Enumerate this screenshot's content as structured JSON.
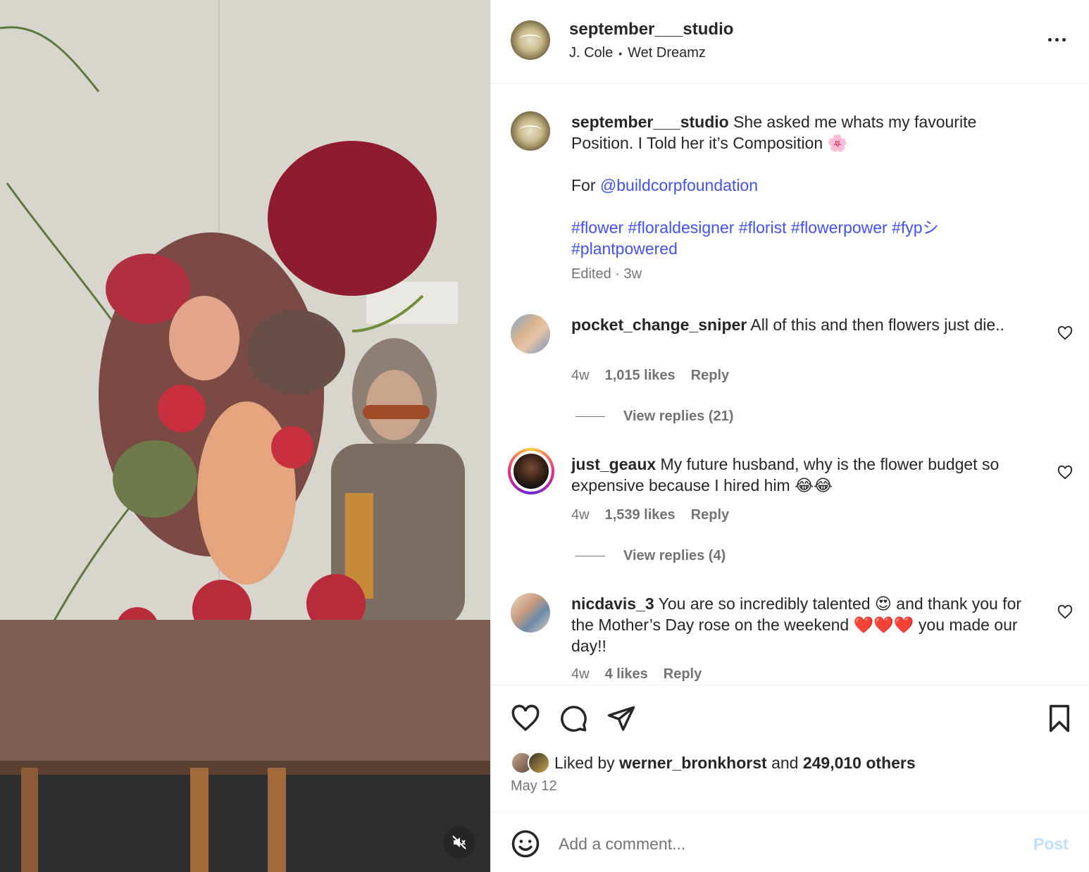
{
  "header": {
    "username": "september___studio",
    "audio_artist": "J. Cole",
    "audio_separator": "•",
    "audio_track": "Wet Dreamz"
  },
  "caption": {
    "username": "september___studio",
    "text": "She asked me whats my favourite Position. I Told her it’s Composition 🌸",
    "for_prefix": "For",
    "mention": "@buildcorpfoundation",
    "hashtags_line1": "#flower #floraldesigner #florist #flowerpower #fypシ",
    "hashtags_line2": "#plantpowered",
    "meta": "Edited · 3w"
  },
  "comments": [
    {
      "username": "pocket_change_sniper",
      "text": "All of this and then flowers just die..",
      "time": "4w",
      "likes": "1,015 likes",
      "reply": "Reply",
      "view_replies": "View replies (21)"
    },
    {
      "username": "just_geaux",
      "text": "My future husband, why is the flower budget so expensive because I hired him 😂😂",
      "time": "4w",
      "likes": "1,539 likes",
      "reply": "Reply",
      "view_replies": "View replies (4)"
    },
    {
      "username": "nicdavis_3",
      "text": "You are so incredibly talented 😍 and thank you for the Mother’s Day rose on the weekend ❤️❤️❤️ you made our day!!",
      "time": "4w",
      "likes": "4 likes",
      "reply": "Reply"
    }
  ],
  "likes": {
    "prefix": "Liked by",
    "user": "werner_bronkhorst",
    "middle": "and",
    "others": "249,010 others"
  },
  "post_date": "May 12",
  "add_comment": {
    "placeholder": "Add a comment...",
    "post_label": "Post"
  },
  "icons": {
    "more": "more-options-icon",
    "like": "heart-icon",
    "comment": "comment-bubble-icon",
    "share": "paper-plane-icon",
    "save": "bookmark-icon",
    "emoji": "emoji-smile-icon",
    "mute": "speaker-muted-icon"
  },
  "colors": {
    "link": "#4150f7",
    "muted_text": "#737373",
    "post_button_disabled": "#c0dffd"
  }
}
